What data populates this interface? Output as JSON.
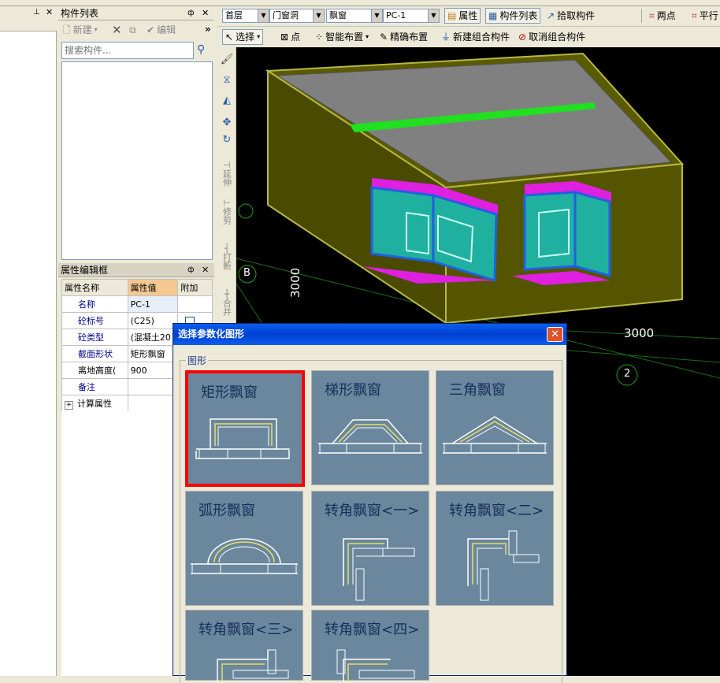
{
  "component_list": {
    "title": "构件列表",
    "new_label": "新建",
    "edit_label": "编辑",
    "search_placeholder": "搜索构件..."
  },
  "toolbar": {
    "floor": "首层",
    "category": "门窗洞",
    "type": "飘窗",
    "component": "PC-1",
    "properties_label": "属性",
    "component_list_label": "构件列表",
    "pick_label": "拾取构件",
    "two_points_label": "两点",
    "parallel_label": "平行",
    "select_label": "选择",
    "point_label": "点",
    "smart_layout_label": "智能布置",
    "precise_layout_label": "精确布置",
    "new_group_label": "新建组合构件",
    "cancel_group_label": "取消组合构件"
  },
  "vertical_tools": [
    "延伸",
    "修剪",
    "打断",
    "合并"
  ],
  "property_panel": {
    "title": "属性编辑框",
    "headers": [
      "属性名称",
      "属性值",
      "附加"
    ],
    "rows": [
      {
        "name": "名称",
        "value": "PC-1"
      },
      {
        "name": "砼标号",
        "value": "(C25)"
      },
      {
        "name": "砼类型",
        "value": "(混凝土20"
      },
      {
        "name": "截面形状",
        "value": "矩形飘窗"
      },
      {
        "name": "离地高度(",
        "value": "900"
      },
      {
        "name": "备注",
        "value": ""
      },
      {
        "name": "计算属性",
        "value": ""
      }
    ]
  },
  "viewport": {
    "axis_b": "B",
    "axis_2": "2",
    "dim_vertical": "3000",
    "dim_horizontal": "3000"
  },
  "dialog": {
    "title": "选择参数化图形",
    "group_label": "图形",
    "shapes": [
      {
        "label": "矩形飘窗",
        "selected": true
      },
      {
        "label": "梯形飘窗",
        "selected": false
      },
      {
        "label": "三角飘窗",
        "selected": false
      },
      {
        "label": "弧形飘窗",
        "selected": false
      },
      {
        "label": "转角飘窗<一>",
        "selected": false
      },
      {
        "label": "转角飘窗<二>",
        "selected": false
      },
      {
        "label": "转角飘窗<三>",
        "selected": false
      },
      {
        "label": "转角飘窗<四>",
        "selected": false
      }
    ]
  },
  "colors": {
    "selection_border": "#ff0000",
    "tile_bg": "#6a879e",
    "viewport_bg": "#000000",
    "wall": "#5a5a00",
    "window_glass": "#20b0a0",
    "window_frame": "#2060e0",
    "sill": "#e020e0",
    "beam": "#20e020"
  }
}
